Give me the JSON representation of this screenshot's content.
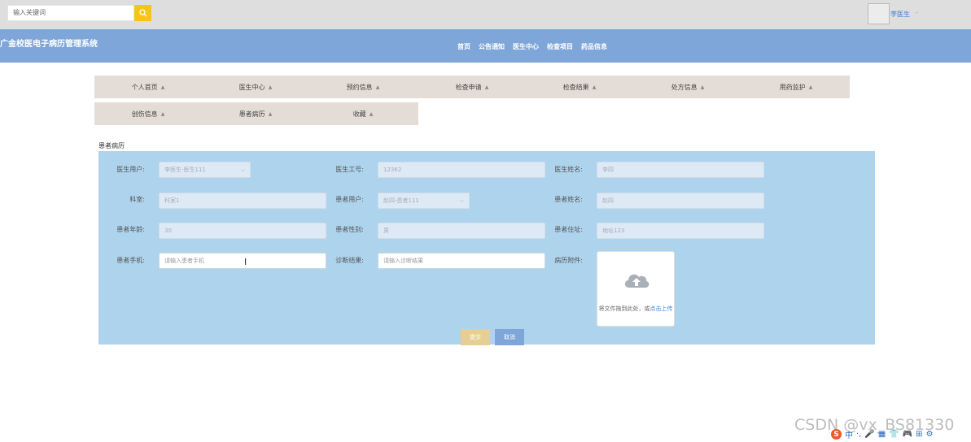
{
  "topbar": {
    "search_placeholder": "输入关键词",
    "username": "李医生",
    "user_caret": "-"
  },
  "header": {
    "title": "广金校医电子病历管理系统",
    "nav": [
      "首页",
      "公告通知",
      "医生中心",
      "检查项目",
      "药品信息"
    ]
  },
  "menu": {
    "row1": [
      "个人首页",
      "医生中心",
      "预约信息",
      "检查申请",
      "检查结果",
      "处方信息",
      "用药监护"
    ],
    "row2": [
      "创伤信息",
      "患者病历",
      "收藏"
    ],
    "arrow": "▲"
  },
  "breadcrumb": "患者病历",
  "form": {
    "doctor_user": {
      "label": "医生用户:",
      "value": "李医生-医生111"
    },
    "doctor_id": {
      "label": "医生工号:",
      "value": "12362"
    },
    "doctor_name": {
      "label": "医生姓名:",
      "value": "李四"
    },
    "department": {
      "label": "科室:",
      "value": "科室1"
    },
    "patient_user": {
      "label": "患者用户:",
      "value": "赵四-患者111"
    },
    "patient_name": {
      "label": "患者姓名:",
      "value": "赵四"
    },
    "patient_age": {
      "label": "患者年龄:",
      "value": "30"
    },
    "patient_gender": {
      "label": "患者性别:",
      "value": "男"
    },
    "patient_address": {
      "label": "患者住址:",
      "value": "地址123"
    },
    "patient_phone": {
      "label": "患者手机:",
      "placeholder": "请输入患者手机"
    },
    "diagnosis": {
      "label": "诊断结果:",
      "placeholder": "请输入诊断结果"
    },
    "attachment": {
      "label": "病历附件:",
      "hint_prefix": "将文件拖到此处，或",
      "hint_link": "点击上传"
    },
    "submit_label": "提交",
    "cancel_label": "取消"
  },
  "watermark": "CSDN @vx_BS81330",
  "ime": {
    "s": "S",
    "zh": "中",
    "items": [
      "·,",
      "🎤",
      "▦",
      "👕",
      "🎮",
      "⊞",
      "⚙"
    ]
  },
  "colors": {
    "header": "#7ea6d8",
    "panel": "#aed3ed",
    "menu": "#e4dcd6",
    "search_button": "#f5c518",
    "submit": "#e6cf95"
  }
}
